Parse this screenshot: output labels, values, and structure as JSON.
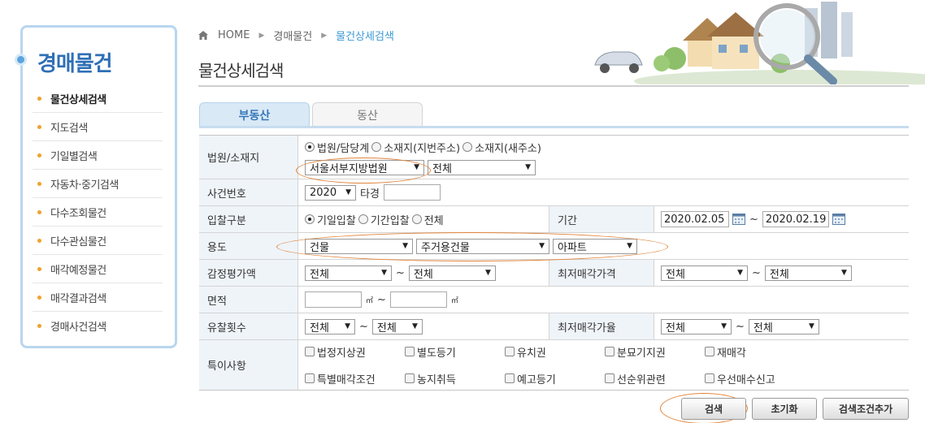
{
  "sidebar": {
    "title": "경매물건",
    "items": [
      {
        "label": "물건상세검색",
        "active": true
      },
      {
        "label": "지도검색",
        "active": false
      },
      {
        "label": "기일별검색",
        "active": false
      },
      {
        "label": "자동차·중기검색",
        "active": false
      },
      {
        "label": "다수조회물건",
        "active": false
      },
      {
        "label": "다수관심물건",
        "active": false
      },
      {
        "label": "매각예정물건",
        "active": false
      },
      {
        "label": "매각결과검색",
        "active": false
      },
      {
        "label": "경매사건검색",
        "active": false
      }
    ]
  },
  "breadcrumb": {
    "home": "HOME",
    "level1": "경매물건",
    "current": "물건상세검색"
  },
  "page_title": "물건상세검색",
  "tabs": [
    {
      "label": "부동산",
      "active": true
    },
    {
      "label": "동산",
      "active": false
    }
  ],
  "form": {
    "court": {
      "label": "법원/소재지",
      "radios": [
        {
          "label": "법원/담당계",
          "checked": true
        },
        {
          "label": "소재지(지번주소)",
          "checked": false
        },
        {
          "label": "소재지(새주소)",
          "checked": false
        }
      ],
      "court_select": "서울서부지방법원",
      "dept_select": "전체"
    },
    "case_no": {
      "label": "사건번호",
      "year": "2020",
      "type_label": "타경",
      "number": ""
    },
    "bid_type": {
      "label": "입찰구분",
      "radios": [
        {
          "label": "기일입찰",
          "checked": true
        },
        {
          "label": "기간입찰",
          "checked": false
        },
        {
          "label": "전체",
          "checked": false
        }
      ]
    },
    "period": {
      "label": "기간",
      "from": "2020.02.05",
      "to": "2020.02.19",
      "sep": "~"
    },
    "usage": {
      "label": "용도",
      "sel1": "건물",
      "sel2": "주거용건물",
      "sel3": "아파트"
    },
    "appraisal": {
      "label": "감정평가액",
      "from": "전체",
      "to": "전체",
      "sep": "~"
    },
    "min_price": {
      "label": "최저매각가격",
      "from": "전체",
      "to": "전체",
      "sep": "~"
    },
    "area": {
      "label": "면적",
      "from": "",
      "to": "",
      "unit": "㎡",
      "sep": "~"
    },
    "fail_count": {
      "label": "유찰횟수",
      "from": "전체",
      "to": "전체",
      "sep": "~"
    },
    "min_rate": {
      "label": "최저매각가율",
      "from": "전체",
      "to": "전체",
      "sep": "~"
    },
    "special": {
      "label": "특이사항",
      "row1": [
        "법정지상권",
        "별도등기",
        "유치권",
        "분묘기지권",
        "재매각"
      ],
      "row2": [
        "특별매각조건",
        "농지취득",
        "예고등기",
        "선순위관련",
        "우선매수신고"
      ]
    }
  },
  "buttons": {
    "search": "검색",
    "reset": "초기화",
    "add_condition": "검색조건추가"
  },
  "colors": {
    "accent": "#2e6fb5",
    "highlight_ellipse": "#e0833a",
    "header_bg": "#eff4f9"
  }
}
